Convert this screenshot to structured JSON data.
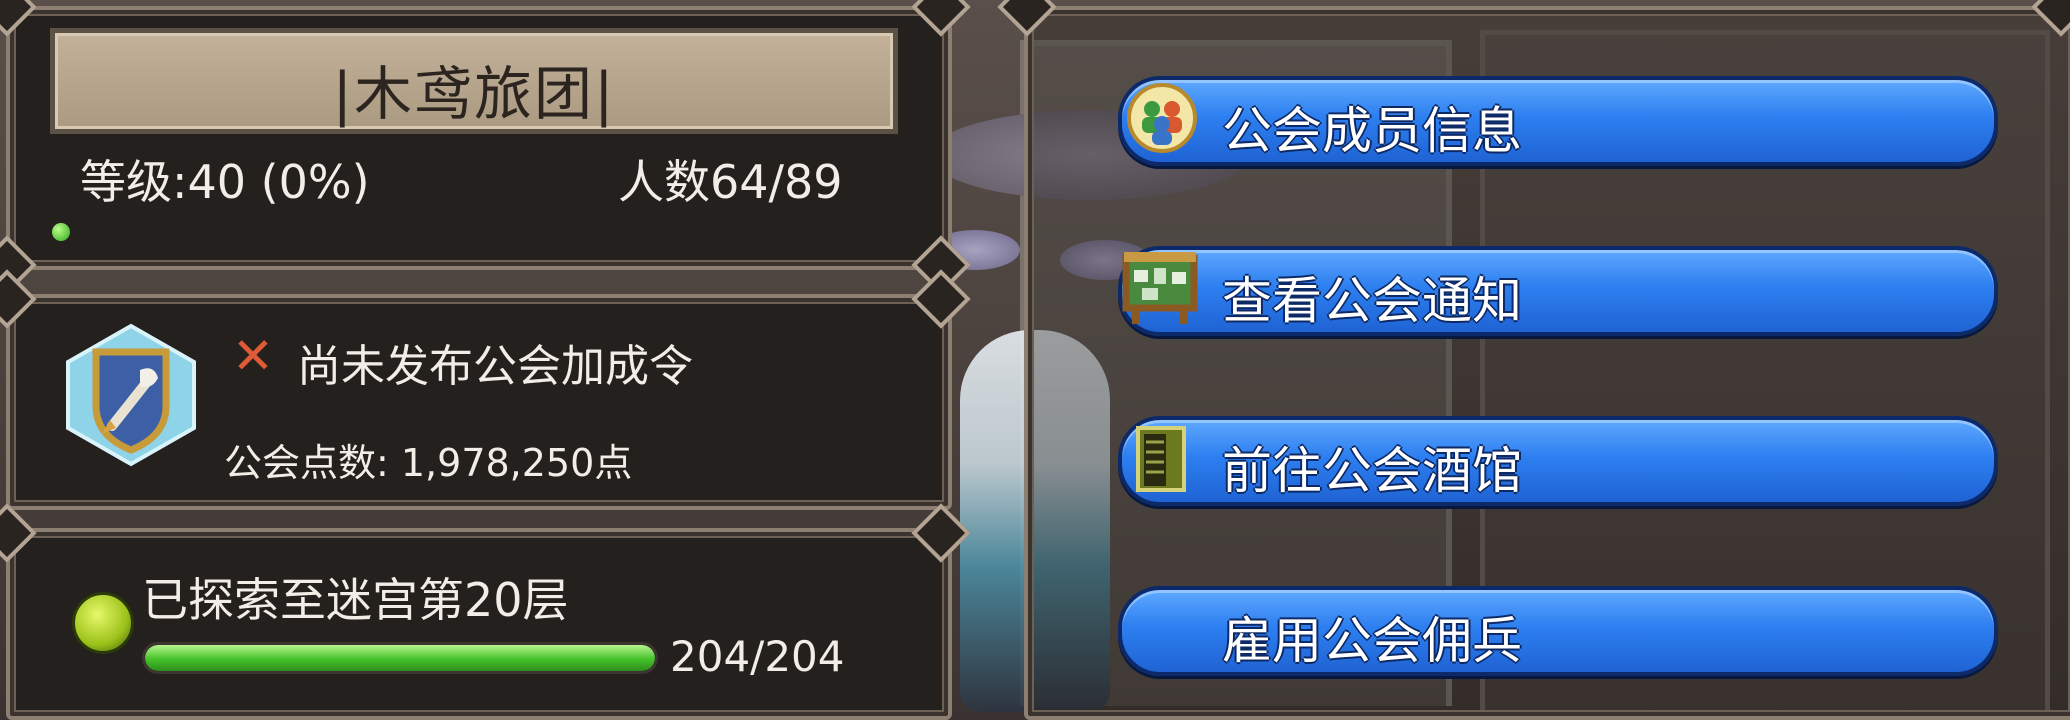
{
  "guild": {
    "name": "|木鸢旅团|",
    "level_text": "等级:40 (0%)",
    "members_text": "人数64/89"
  },
  "bonus": {
    "status_text": "尚未发布公会加成令",
    "points_text": "公会点数: 1,978,250点"
  },
  "labyrinth": {
    "explored_text": "已探索至迷宫第20层",
    "progress_text": "204/204",
    "progress_fraction": 1.0
  },
  "menu": [
    {
      "label": "公会成员信息",
      "icon": "members-icon"
    },
    {
      "label": "查看公会通知",
      "icon": "notice-board-icon"
    },
    {
      "label": "前往公会酒馆",
      "icon": "tavern-door-icon"
    },
    {
      "label": "雇用公会佣兵",
      "icon": ""
    }
  ],
  "colors": {
    "panel_bg": "#24201e",
    "panel_border": "#8d7f72",
    "button_blue": "#2d7ff0",
    "progress_green": "#44c22b",
    "x_red": "#e05a35"
  }
}
